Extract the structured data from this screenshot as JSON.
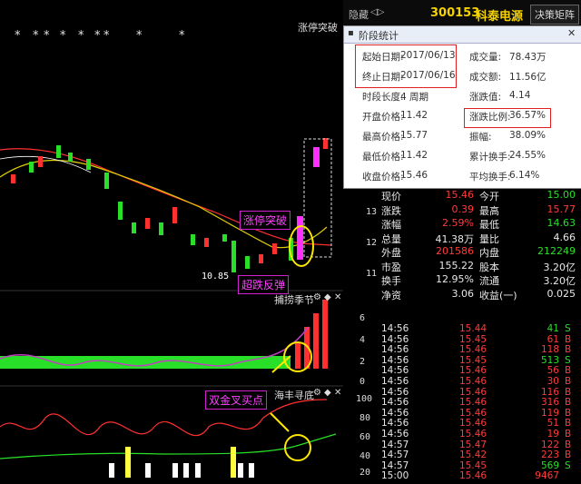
{
  "topbar": {
    "hide_label": "隐藏",
    "arrow_label": "◁▷",
    "stock_code": "300153",
    "stock_name": "科泰电源",
    "decision_btn": "决策矩阵"
  },
  "main_chart": {
    "stars": [
      "*",
      "*",
      "*",
      "*",
      "*",
      "*",
      "*",
      "*",
      "*"
    ],
    "limit_label": "涨停突破",
    "low_price_label": "10.85",
    "annotation_breakout": "涨停突破",
    "annotation_rebound": "超跌反弹",
    "price_scale": [
      "13",
      "12",
      "11"
    ]
  },
  "macd_panel": {
    "title": "捕捞季节",
    "scale": [
      "6",
      "4",
      "2",
      "0",
      "-2"
    ]
  },
  "kdj_panel": {
    "title": "海丰寻底",
    "annotation": "双金叉买点",
    "scale": [
      "100",
      "80",
      "60",
      "40",
      "20",
      "0"
    ]
  },
  "popup": {
    "title": "阶段统计",
    "rows": [
      {
        "l1": "起始日期:",
        "v1": "2017/06/13",
        "l2": "成交量:",
        "v2": "78.43万"
      },
      {
        "l1": "终止日期:",
        "v1": "2017/06/16",
        "l2": "成交额:",
        "v2": "11.56亿"
      },
      {
        "l1": "时段长度:",
        "v1": "4 周期",
        "l2": "涨跌值:",
        "v2": "4.14"
      },
      {
        "l1": "开盘价格:",
        "v1": "11.42",
        "l2": "涨跌比例:",
        "v2": "36.57%"
      },
      {
        "l1": "最高价格:",
        "v1": "15.77",
        "l2": "振幅:",
        "v2": "38.09%"
      },
      {
        "l1": "最低价格:",
        "v1": "11.42",
        "l2": "累计换手:",
        "v2": "24.55%"
      },
      {
        "l1": "收盘价格:",
        "v1": "15.46",
        "l2": "平均换手:",
        "v2": "6.14%"
      }
    ]
  },
  "quote": {
    "rows": [
      {
        "l1": "现价",
        "v1": "15.46",
        "l2": "今开",
        "v2": "15.00"
      },
      {
        "l1": "涨跌",
        "v1": "0.39",
        "l2": "最高",
        "v2": "15.77"
      },
      {
        "l1": "涨幅",
        "v1": "2.59%",
        "l2": "最低",
        "v2": "14.63"
      },
      {
        "l1": "总量",
        "v1": "41.38万",
        "l2": "量比",
        "v2": "4.66"
      },
      {
        "l1": "外盘",
        "v1": "201586",
        "l2": "内盘",
        "v2": "212249"
      },
      {
        "l1": "市盈",
        "v1": "155.22",
        "l2": "股本",
        "v2": "3.20亿"
      },
      {
        "l1": "换手",
        "v1": "12.95%",
        "l2": "流通",
        "v2": "3.20亿"
      },
      {
        "l1": "净资",
        "v1": "3.06",
        "l2": "收益(一)",
        "v2": "0.025"
      }
    ]
  },
  "ticks": [
    {
      "time": "14:56",
      "price": "15.44",
      "vol": "41",
      "side": "S"
    },
    {
      "time": "14:56",
      "price": "15.45",
      "vol": "61",
      "side": "B"
    },
    {
      "time": "14:56",
      "price": "15.46",
      "vol": "118",
      "side": "B"
    },
    {
      "time": "14:56",
      "price": "15.45",
      "vol": "513",
      "side": "S"
    },
    {
      "time": "14:56",
      "price": "15.46",
      "vol": "56",
      "side": "B"
    },
    {
      "time": "14:56",
      "price": "15.46",
      "vol": "30",
      "side": "B"
    },
    {
      "time": "14:56",
      "price": "15.46",
      "vol": "116",
      "side": "B"
    },
    {
      "time": "14:56",
      "price": "15.46",
      "vol": "316",
      "side": "B"
    },
    {
      "time": "14:56",
      "price": "15.46",
      "vol": "119",
      "side": "B"
    },
    {
      "time": "14:56",
      "price": "15.46",
      "vol": "51",
      "side": "B"
    },
    {
      "time": "14:56",
      "price": "15.46",
      "vol": "19",
      "side": "B"
    },
    {
      "time": "14:57",
      "price": "15.47",
      "vol": "122",
      "side": "B"
    },
    {
      "time": "14:57",
      "price": "15.42",
      "vol": "223",
      "side": "B"
    },
    {
      "time": "14:57",
      "price": "15.45",
      "vol": "569",
      "side": "S"
    },
    {
      "time": "15:00",
      "price": "15.46",
      "vol": "9467",
      "side": ""
    }
  ],
  "colors": {
    "up": "#ff3b3b",
    "down": "#27e027",
    "accent": "#f5d300",
    "magenta": "#ff40ff"
  }
}
